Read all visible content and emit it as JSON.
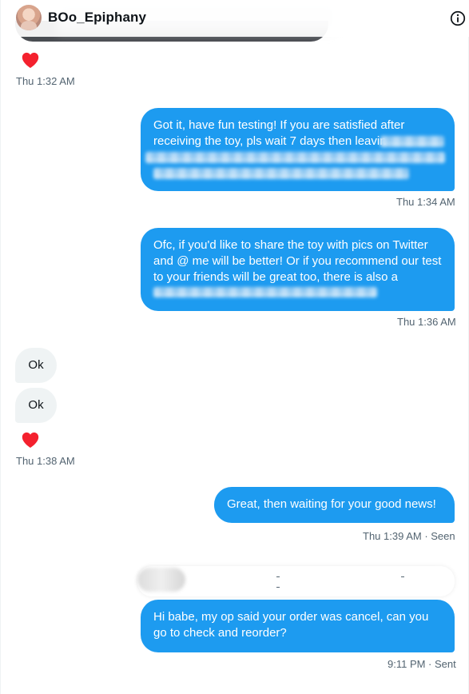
{
  "header": {
    "title": "BOo_Epiphany",
    "avatar_icon": "user-avatar",
    "info_icon": "info-circle-icon"
  },
  "messages": {
    "heart_1": {
      "icon": "heart-icon",
      "timestamp": "Thu 1:32 AM"
    },
    "out_1": {
      "text": "Got it, have fun testing! If you are satisfied after receiving the toy, pls wait 7 days then leavin",
      "timestamp": "Thu 1:34 AM"
    },
    "out_2": {
      "text": "Ofc, if you'd like to share the toy with pics on Twitter and @ me will be better! Or if you recommend our test to your friends will be great too, there is also a",
      "timestamp": "Thu 1:36 AM"
    },
    "in_1": {
      "text": "Ok"
    },
    "in_2": {
      "text": "Ok"
    },
    "heart_2": {
      "icon": "heart-icon",
      "timestamp": "Thu 1:38 AM"
    },
    "out_3": {
      "text": "Great, then waiting for your good news!",
      "timestamp": "Thu 1:39 AM · Seen"
    },
    "out_4": {
      "text": "Hi babe, my op said your order was cancel, can you go to check and reorder?",
      "timestamp": "9:11 PM · Sent"
    }
  },
  "colors": {
    "accent": "#1d9bf0",
    "heart": "#f91880",
    "incoming_bubble": "#eff3f4",
    "muted_text": "#536471"
  }
}
